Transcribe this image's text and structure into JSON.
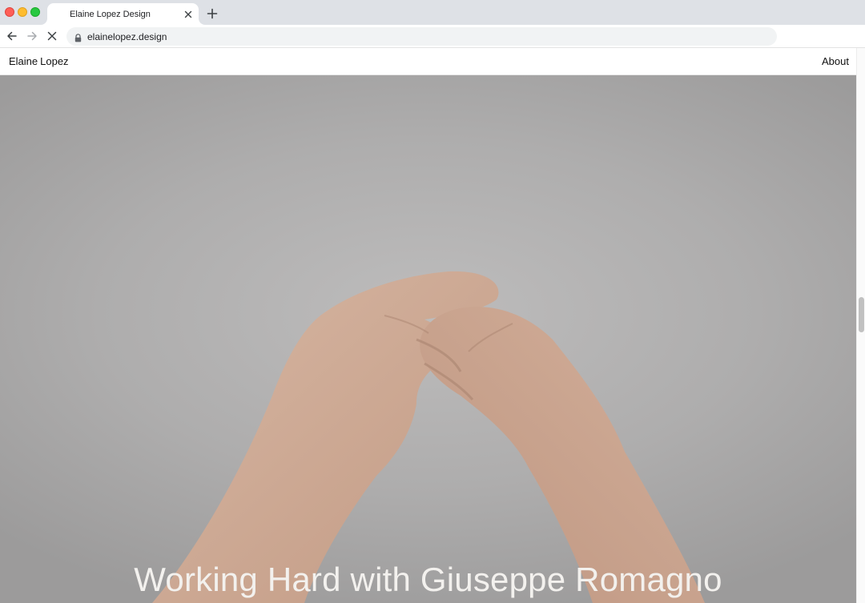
{
  "browser": {
    "tab": {
      "title": "Elaine Lopez Design"
    },
    "address": {
      "url": "elainelopez.design"
    },
    "icons": {
      "close": "close-icon",
      "new_tab": "plus-icon",
      "back": "arrow-left-icon",
      "forward": "arrow-right-icon",
      "stop": "stop-loading-icon",
      "lock": "lock-icon"
    }
  },
  "site": {
    "name_first": "Elaine",
    "name_last": "Lopez",
    "nav": {
      "about": "About"
    }
  },
  "hero": {
    "title": "Working Hard with Giuseppe Romagno",
    "background_color": "#aeadad",
    "title_color": "#f3f1ee"
  },
  "colors": {
    "chrome_bg": "#dee1e6",
    "omnibox_bg": "#f1f3f4",
    "close_red": "#fe5f57",
    "minimize_yellow": "#febc2e",
    "zoom_green": "#28c840"
  }
}
